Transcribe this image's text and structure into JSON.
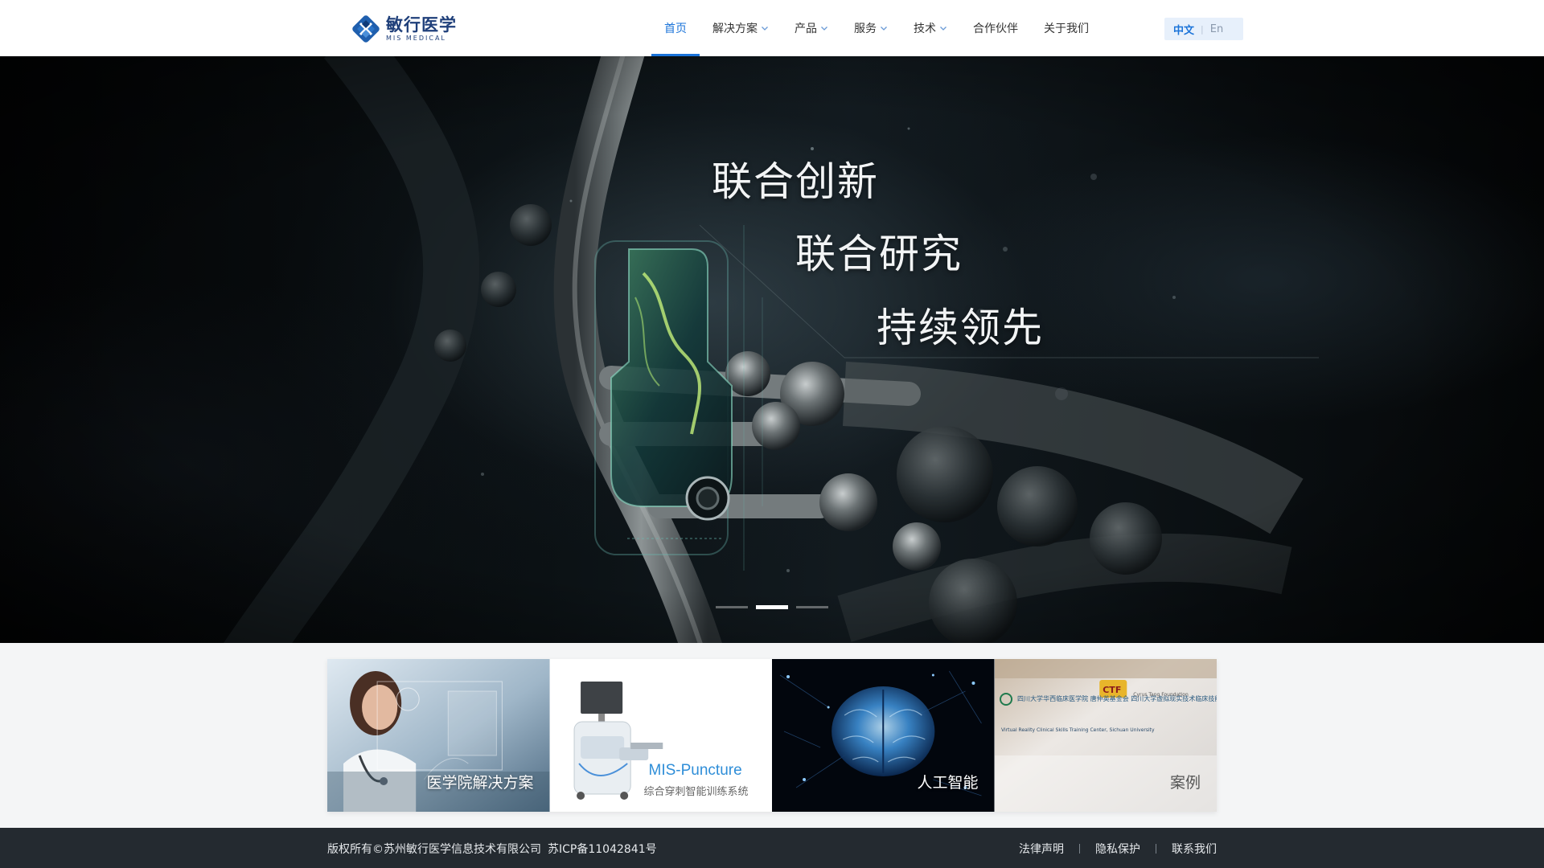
{
  "brand": {
    "name_cn": "敏行医学",
    "name_en": "MIS MEDICAL"
  },
  "nav": [
    {
      "label": "首页",
      "active": true,
      "dropdown": false,
      "name": "nav-home"
    },
    {
      "label": "解决方案",
      "active": false,
      "dropdown": true,
      "name": "nav-solutions"
    },
    {
      "label": "产品",
      "active": false,
      "dropdown": true,
      "name": "nav-products"
    },
    {
      "label": "服务",
      "active": false,
      "dropdown": true,
      "name": "nav-services"
    },
    {
      "label": "技术",
      "active": false,
      "dropdown": true,
      "name": "nav-technology"
    },
    {
      "label": "合作伙伴",
      "active": false,
      "dropdown": false,
      "name": "nav-partners"
    },
    {
      "label": "关于我们",
      "active": false,
      "dropdown": false,
      "name": "nav-about"
    }
  ],
  "language": {
    "zh": "中文",
    "separator": "|",
    "en": "En",
    "selected": "zh"
  },
  "hero": {
    "lines": [
      "联合创新",
      "联合研究",
      "持续领先"
    ],
    "slides_total": 3,
    "active_slide": 2
  },
  "cards": [
    {
      "label": "医学院解决方案"
    },
    {
      "title": "MIS-Puncture",
      "subtitle": "综合穿刺智能训练系统"
    },
    {
      "label": "人工智能"
    },
    {
      "label": "案例",
      "sign_cn": "四川大学华西临床医学院 唐仲英基金会 四川大学虚拟现实技术临床技能实验教学中心",
      "sign_org": "CTF",
      "sign_en": "Cyrus Tang Foundation",
      "sign_en2": "Virtual Reality Clinical Skills Training Center, Sichuan University"
    }
  ],
  "footer": {
    "copyright": "版权所有©苏州敏行医学信息技术有限公司",
    "icp": "苏ICP备11042841号",
    "links": [
      "法律声明",
      "隐私保护",
      "联系我们"
    ]
  },
  "colors": {
    "accent": "#1a73d9",
    "brand": "#1f3f7a",
    "footer_bg": "#242a30",
    "lang_bg": "#e7f0fb"
  }
}
